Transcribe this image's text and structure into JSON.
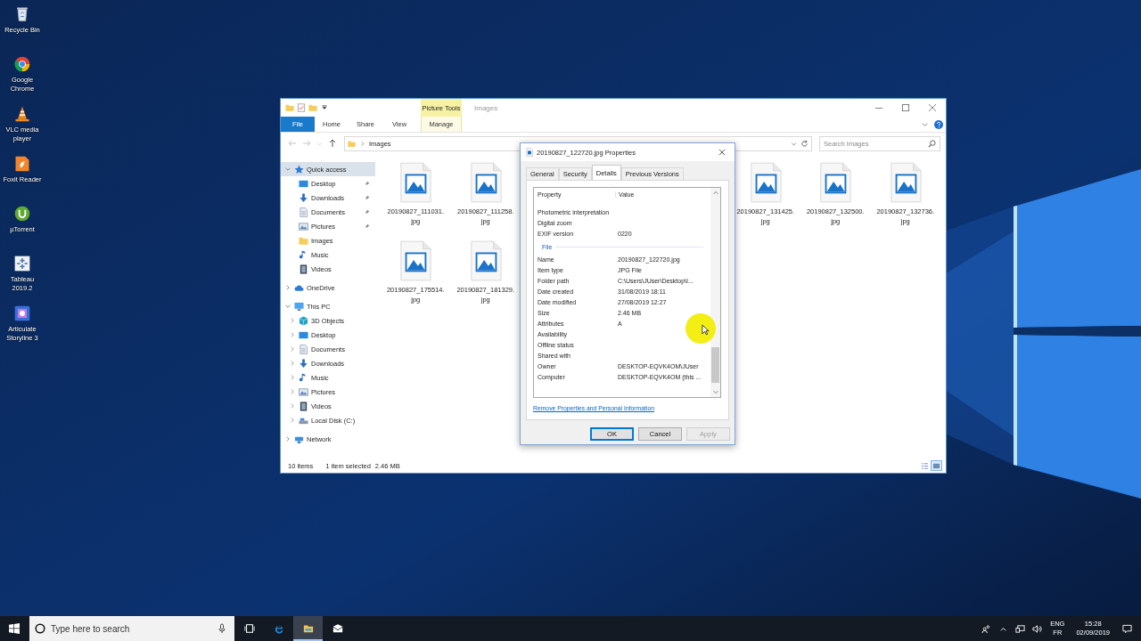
{
  "desktop_icons": [
    {
      "label": "Recycle Bin"
    },
    {
      "label": "Google Chrome"
    },
    {
      "label": "VLC media player"
    },
    {
      "label": "Foxit Reader"
    },
    {
      "label": "µTorrent"
    },
    {
      "label": "Tableau 2019.2"
    },
    {
      "label": "Articulate Storyline 3"
    }
  ],
  "explorer": {
    "title": "Images",
    "context_group": "Picture Tools",
    "ribbon_tabs": [
      {
        "label": "File",
        "kind": "file"
      },
      {
        "label": "Home",
        "kind": "tab"
      },
      {
        "label": "Share",
        "kind": "tab"
      },
      {
        "label": "View",
        "kind": "tab"
      },
      {
        "label": "Manage",
        "kind": "context"
      }
    ],
    "address": {
      "path": "Images"
    },
    "search": {
      "placeholder": "Search Images"
    },
    "nav": [
      {
        "label": "Quick access",
        "kind": "star",
        "expanded": true,
        "selected": true,
        "children": [
          {
            "label": "Desktop",
            "kind": "desktop",
            "pinned": true,
            "selected": false
          },
          {
            "label": "Downloads",
            "kind": "downloads",
            "pinned": true,
            "selected": false
          },
          {
            "label": "Documents",
            "kind": "documents",
            "pinned": true,
            "selected": false
          },
          {
            "label": "Pictures",
            "kind": "pictures",
            "pinned": true,
            "selected": false
          },
          {
            "label": "Images",
            "kind": "folder",
            "pinned": false,
            "selected": false
          },
          {
            "label": "Music",
            "kind": "music",
            "pinned": false,
            "selected": false
          },
          {
            "label": "Videos",
            "kind": "videos",
            "pinned": false,
            "selected": false
          }
        ]
      },
      {
        "label": "OneDrive",
        "kind": "cloud",
        "expanded": false,
        "selected": false
      },
      {
        "label": "This PC",
        "kind": "pc",
        "expanded": true,
        "selected": false,
        "children": [
          {
            "label": "3D Objects",
            "kind": "objects3d",
            "expanded": false,
            "selected": false
          },
          {
            "label": "Desktop",
            "kind": "desktop",
            "expanded": false,
            "selected": false
          },
          {
            "label": "Documents",
            "kind": "documents",
            "expanded": false,
            "selected": false
          },
          {
            "label": "Downloads",
            "kind": "downloads",
            "expanded": false,
            "selected": false
          },
          {
            "label": "Music",
            "kind": "music",
            "expanded": false,
            "selected": false
          },
          {
            "label": "Pictures",
            "kind": "pictures",
            "expanded": false,
            "selected": false
          },
          {
            "label": "Videos",
            "kind": "videos",
            "expanded": false,
            "selected": false
          },
          {
            "label": "Local Disk (C:)",
            "kind": "disk",
            "expanded": false,
            "selected": false
          }
        ]
      },
      {
        "label": "Network",
        "kind": "network",
        "expanded": false,
        "selected": false
      }
    ],
    "files": [
      {
        "name": "20190827_111031.jpg"
      },
      {
        "name": "20190827_111258.jpg"
      },
      {
        "name": "20190827_131425.jpg"
      },
      {
        "name": "20190827_132500.jpg"
      },
      {
        "name": "20190827_132736.jpg"
      },
      {
        "name": "20190827_175514.jpg"
      },
      {
        "name": "20190827_181329.jpg"
      }
    ],
    "status": {
      "count": "10 items",
      "selection": "1 item selected",
      "size": "2.46 MB"
    },
    "view_buttons": [
      {
        "kind": "details",
        "selected": false
      },
      {
        "kind": "large-icons",
        "selected": true
      }
    ]
  },
  "dialog": {
    "title": "20190827_122720.jpg Properties",
    "tabs": [
      {
        "label": "General",
        "selected": false
      },
      {
        "label": "Security",
        "selected": false
      },
      {
        "label": "Details",
        "selected": true
      },
      {
        "label": "Previous Versions",
        "selected": false
      }
    ],
    "columns": [
      "Property",
      "Value"
    ],
    "rows": [
      {
        "kind": "row",
        "property": "Photometric interpretation"
      },
      {
        "kind": "row",
        "property": "Digital zoom"
      },
      {
        "kind": "row",
        "property": "EXIF version",
        "value": "0220"
      },
      {
        "kind": "group",
        "property": "File"
      },
      {
        "kind": "row",
        "property": "Name",
        "value": "20190827_122720.jpg"
      },
      {
        "kind": "row",
        "property": "Item type",
        "value": "JPG File"
      },
      {
        "kind": "row",
        "property": "Folder path",
        "value": "C:\\Users\\JUser\\Desktop\\I..."
      },
      {
        "kind": "row",
        "property": "Date created",
        "value": "31/08/2019 18:11"
      },
      {
        "kind": "row",
        "property": "Date modified",
        "value": "27/08/2019 12:27"
      },
      {
        "kind": "row",
        "property": "Size",
        "value": "2.46 MB"
      },
      {
        "kind": "row",
        "property": "Attributes",
        "value": "A"
      },
      {
        "kind": "row",
        "property": "Availability"
      },
      {
        "kind": "row",
        "property": "Offline status"
      },
      {
        "kind": "row",
        "property": "Shared with"
      },
      {
        "kind": "row",
        "property": "Owner",
        "value": "DESKTOP-EQVK4OM\\JUser"
      },
      {
        "kind": "row",
        "property": "Computer",
        "value": "DESKTOP-EQVK4OM (this ..."
      }
    ],
    "link": "Remove Properties and Personal Information",
    "buttons": [
      {
        "label": "OK",
        "default": true,
        "disabled": false
      },
      {
        "label": "Cancel",
        "default": false,
        "disabled": false
      },
      {
        "label": "Apply",
        "default": false,
        "disabled": true
      }
    ]
  },
  "taskbar": {
    "search": {
      "placeholder": "Type here to search"
    },
    "apps": [
      {
        "kind": "task-view",
        "active": false
      },
      {
        "kind": "edge",
        "active": false
      },
      {
        "kind": "explorer",
        "active": true
      },
      {
        "kind": "mail",
        "active": false
      }
    ],
    "language": "ENG",
    "keyboard": "FR",
    "time": "15:28",
    "date": "02/09/2019"
  }
}
